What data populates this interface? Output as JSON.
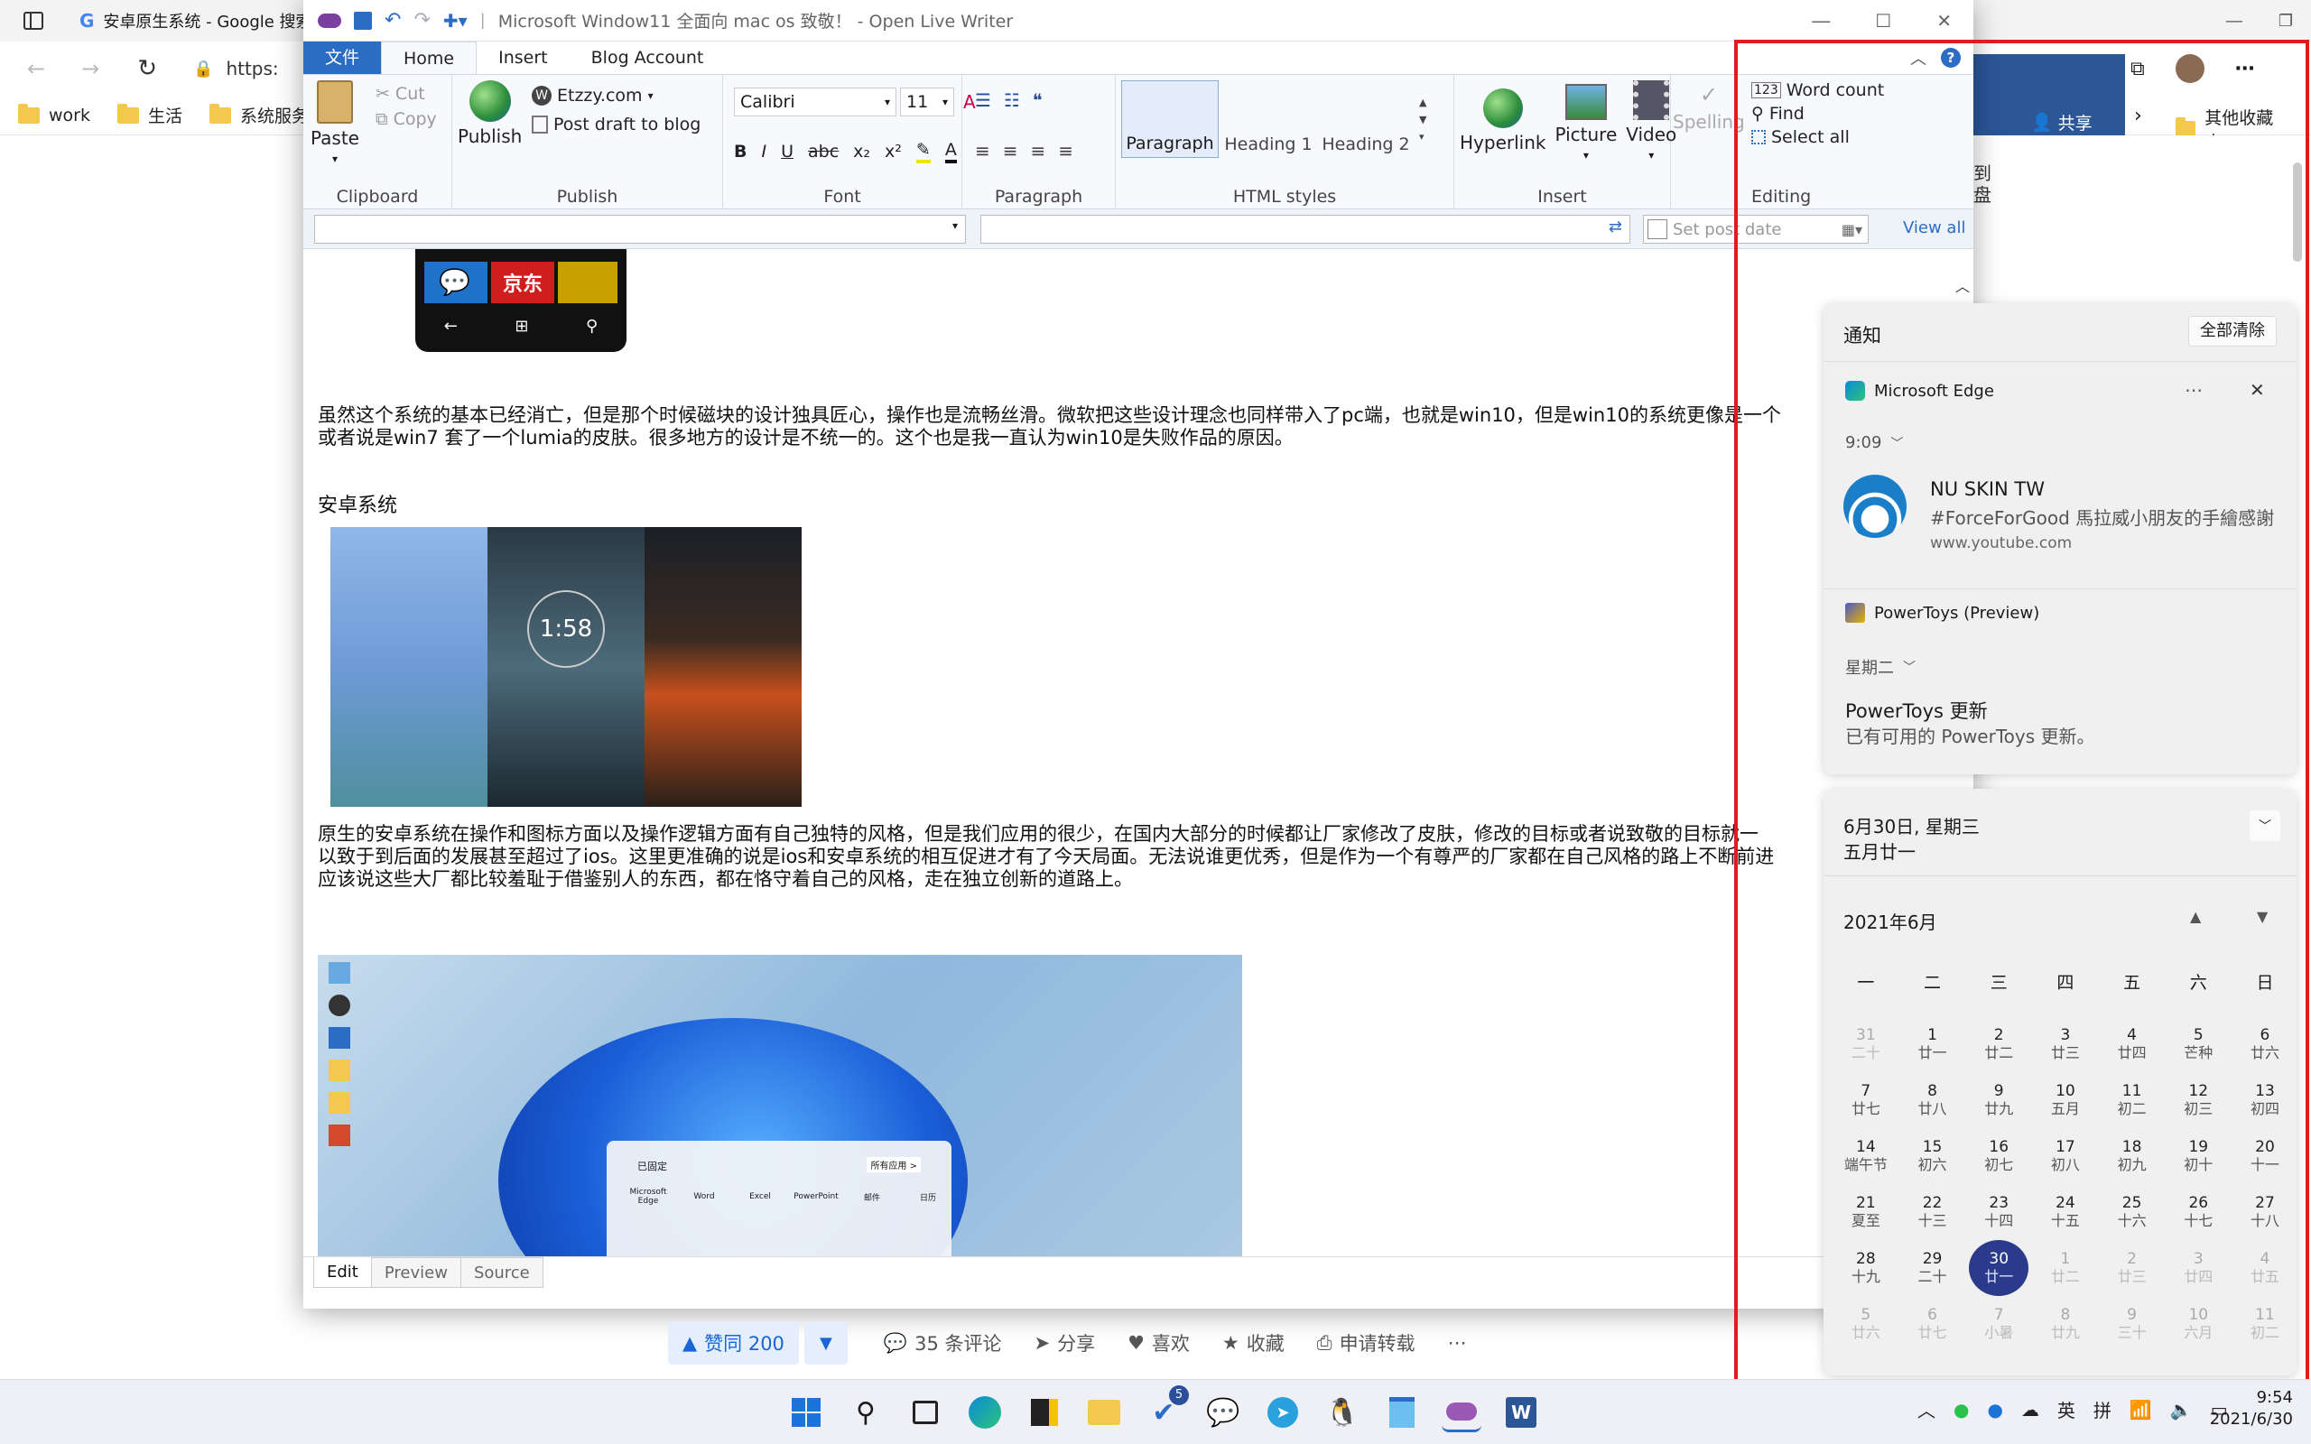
{
  "browser": {
    "tab_title": "安卓原生系统 - Google 搜索",
    "address": "https:",
    "favorites": [
      "work",
      "生活",
      "系统服务"
    ],
    "other_favorites": "其他收藏夹",
    "side_share": "共享",
    "side_text": [
      "到",
      "盘"
    ]
  },
  "writer": {
    "title": "Microsoft Window11 全面向 mac os 致敬！ - Open Live Writer",
    "tabs": [
      "文件",
      "Home",
      "Insert",
      "Blog Account"
    ],
    "clipboard": {
      "paste": "Paste",
      "cut": "Cut",
      "copy": "Copy",
      "label": "Clipboard"
    },
    "publish": {
      "publish": "Publish",
      "account": "Etzzy.com",
      "draft": "Post draft to blog",
      "label": "Publish"
    },
    "font": {
      "name": "Calibri",
      "size": "11",
      "label": "Font"
    },
    "paragraph": {
      "label": "Paragraph"
    },
    "styles": {
      "items": [
        "Paragraph",
        "Heading 1",
        "Heading 2"
      ],
      "label": "HTML styles"
    },
    "insert": {
      "items": [
        "Hyperlink",
        "Picture",
        "Video"
      ],
      "label": "Insert"
    },
    "spelling": "Spelling",
    "editing": {
      "word_count": "Word count",
      "find": "Find",
      "select_all": "Select all",
      "label": "Editing"
    },
    "set_post_date": "Set post date",
    "view_all": "View all",
    "body": {
      "para1_line1": "虽然这个系统的基本已经消亡，但是那个时候磁块的设计独具匠心，操作也是流畅丝滑。微软把这些设计理念也同样带入了pc端，也就是win10，但是win10的系统更像是一个",
      "para1_line2": "或者说是win7 套了一个lumia的皮肤。很多地方的设计是不统一的。这个也是我一直认为win10是失败作品的原因。",
      "heading": "安卓系统",
      "para2_line1": "原生的安卓系统在操作和图标方面以及操作逻辑方面有自己独特的风格，但是我们应用的很少，在国内大部分的时候都让厂家修改了皮肤，修改的目标或者说致敬的目标就一",
      "para2_line2": "以致于到后面的发展甚至超过了ios。这里更准确的说是ios和安卓系统的相互促进才有了今天局面。无法说谁更优秀，但是作为一个有尊严的厂家都在自己风格的路上不断前进",
      "para2_line3": "应该说这些大厂都比较羞耻于借鉴别人的东西，都在恪守着自己的风格，走在独立创新的道路上。",
      "lumia_tile": "京东",
      "android_clock": "1:58",
      "start_menu_title": "已固定",
      "start_menu_btn": "所有应用 >",
      "start_apps": [
        "Microsoft Edge",
        "Word",
        "Excel",
        "PowerPoint",
        "邮件",
        "日历"
      ]
    },
    "view_tabs": [
      "Edit",
      "Preview",
      "Source"
    ]
  },
  "engage": {
    "like": "赞同 200",
    "comments": "35 条评论",
    "share": "分享",
    "love": "喜欢",
    "favorite": "收藏",
    "repost": "申请转载"
  },
  "notifications": {
    "title": "通知",
    "clear_all": "全部清除",
    "edge_app": "Microsoft Edge",
    "edge_time": "9:09",
    "edge_sender": "NU SKIN TW",
    "edge_text": "#ForceForGood 馬拉威小朋友的手繪感謝",
    "edge_source": "www.youtube.com",
    "pt_app": "PowerToys (Preview)",
    "pt_time": "星期二",
    "pt_title": "PowerToys 更新",
    "pt_text": "已有可用的 PowerToys 更新。"
  },
  "calendar": {
    "date_line": "6月30日, 星期三",
    "lunar_line": "五月廿一",
    "month": "2021年6月",
    "weekdays": [
      "一",
      "二",
      "三",
      "四",
      "五",
      "六",
      "日"
    ],
    "days": [
      [
        "31",
        "二十"
      ],
      [
        "1",
        "廿一"
      ],
      [
        "2",
        "廿二"
      ],
      [
        "3",
        "廿三"
      ],
      [
        "4",
        "廿四"
      ],
      [
        "5",
        "芒种"
      ],
      [
        "6",
        "廿六"
      ],
      [
        "7",
        "廿七"
      ],
      [
        "8",
        "廿八"
      ],
      [
        "9",
        "廿九"
      ],
      [
        "10",
        "五月"
      ],
      [
        "11",
        "初二"
      ],
      [
        "12",
        "初三"
      ],
      [
        "13",
        "初四"
      ],
      [
        "14",
        "端午节"
      ],
      [
        "15",
        "初六"
      ],
      [
        "16",
        "初七"
      ],
      [
        "17",
        "初八"
      ],
      [
        "18",
        "初九"
      ],
      [
        "19",
        "初十"
      ],
      [
        "20",
        "十一"
      ],
      [
        "21",
        "夏至"
      ],
      [
        "22",
        "十三"
      ],
      [
        "23",
        "十四"
      ],
      [
        "24",
        "十五"
      ],
      [
        "25",
        "十六"
      ],
      [
        "26",
        "十七"
      ],
      [
        "27",
        "十八"
      ],
      [
        "28",
        "十九"
      ],
      [
        "29",
        "二十"
      ],
      [
        "30",
        "廿一"
      ],
      [
        "1",
        "廿二"
      ],
      [
        "2",
        "廿三"
      ],
      [
        "3",
        "廿四"
      ],
      [
        "4",
        "廿五"
      ],
      [
        "5",
        "廿六"
      ],
      [
        "6",
        "廿七"
      ],
      [
        "7",
        "小暑"
      ],
      [
        "8",
        "廿九"
      ],
      [
        "9",
        "三十"
      ],
      [
        "10",
        "六月"
      ],
      [
        "11",
        "初二"
      ]
    ]
  },
  "taskbar": {
    "badge_count": "5",
    "ime_lang": "英",
    "ime_mode": "拼",
    "time": "9:54",
    "date": "2021/6/30"
  },
  "colors": {
    "accent": "#2b6cc4",
    "today": "#2c3a8c",
    "highlight_box": "#e11c1c"
  }
}
